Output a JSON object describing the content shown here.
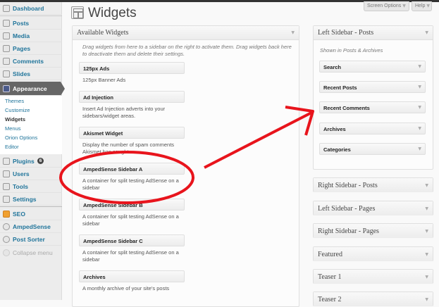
{
  "sidebar": {
    "items": [
      "Dashboard",
      "Posts",
      "Media",
      "Pages",
      "Comments",
      "Slides",
      "Appearance",
      "Plugins",
      "Users",
      "Tools",
      "Settings",
      "SEO",
      "AmpedSense",
      "Post Sorter",
      "Collapse menu"
    ],
    "submenu": [
      "Themes",
      "Customize",
      "Widgets",
      "Menus",
      "Orion Options",
      "Editor"
    ],
    "plugins_badge": "6"
  },
  "header": {
    "title": "Widgets",
    "screen_options": "Screen Options",
    "help": "Help"
  },
  "available": {
    "title": "Available Widgets",
    "hint": "Drag widgets from here to a sidebar on the right to activate them. Drag widgets back here to deactivate them and delete their settings.",
    "widgets": [
      {
        "name": "125px Ads",
        "desc": "125px Banner Ads"
      },
      {
        "name": "Ad Injection",
        "desc": "Insert Ad Injection adverts into your sidebars/widget areas."
      },
      {
        "name": "Akismet Widget",
        "desc": "Display the number of spam comments Akismet has caught"
      },
      {
        "name": "AmpedSense Sidebar A",
        "desc": "A container for split testing AdSense on a sidebar"
      },
      {
        "name": "AmpedSense Sidebar B",
        "desc": "A container for split testing AdSense on a sidebar"
      },
      {
        "name": "AmpedSense Sidebar C",
        "desc": "A container for split testing AdSense on a sidebar"
      },
      {
        "name": "Archives",
        "desc": "A monthly archive of your site's posts"
      }
    ]
  },
  "left_sidebar_posts": {
    "title": "Left Sidebar - Posts",
    "desc": "Shown in Posts & Archives",
    "widgets": [
      "Search",
      "Recent Posts",
      "Recent Comments",
      "Archives",
      "Categories"
    ]
  },
  "other_sidebars": [
    "Right Sidebar - Posts",
    "Left Sidebar - Pages",
    "Right Sidebar - Pages",
    "Featured",
    "Teaser 1",
    "Teaser 2"
  ],
  "annotation_color": "#e8141c"
}
